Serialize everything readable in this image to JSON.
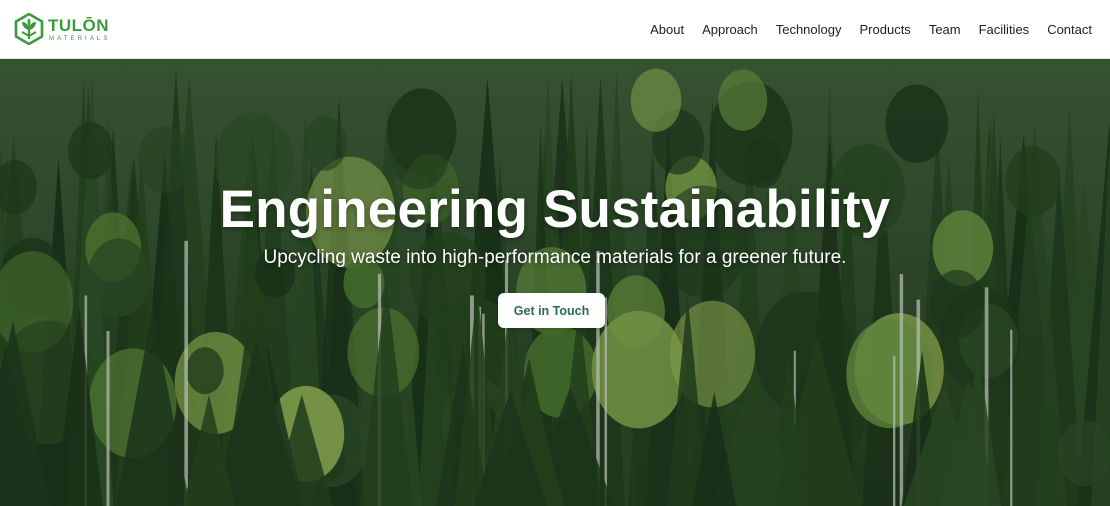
{
  "brand": {
    "name": "TULŌN",
    "tagline": "MATERIALS",
    "color": "#3a9a3c",
    "logo_icon": "hexagon-leaf-icon"
  },
  "nav": {
    "items": [
      {
        "label": "About"
      },
      {
        "label": "Approach"
      },
      {
        "label": "Technology"
      },
      {
        "label": "Products"
      },
      {
        "label": "Team"
      },
      {
        "label": "Facilities"
      },
      {
        "label": "Contact"
      }
    ]
  },
  "hero": {
    "title": "Engineering Sustainability",
    "subtitle": "Upcycling waste into high-performance materials for a greener future.",
    "cta_label": "Get in Touch",
    "cta_text_color": "#2b6e4a",
    "background": "forest-photo"
  }
}
